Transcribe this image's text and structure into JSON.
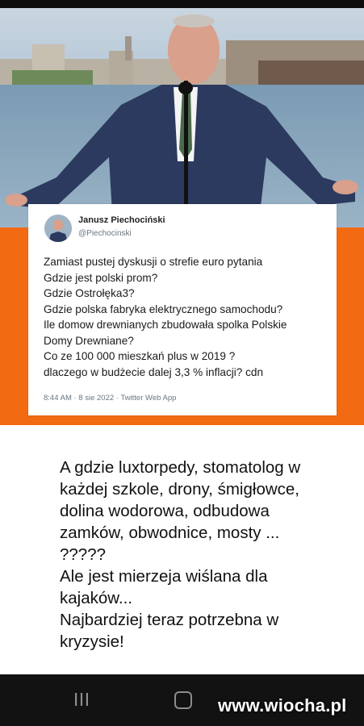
{
  "tweet": {
    "author_name": "Janusz Piechociński",
    "author_handle": "@Piechocinski",
    "lines": [
      "Zamiast pustej dyskusji o strefie euro pytania",
      "Gdzie jest polski prom?",
      "Gdzie Ostrołęka3?",
      "Gdzie polska fabryka elektrycznego samochodu?",
      "Ile domow drewnianych zbudowała spolka Polskie",
      "Domy Drewniane?",
      "Co ze 100 000 mieszkań plus w 2019 ?",
      "dlaczego w budżecie dalej 3,3 % inflacji? cdn"
    ],
    "meta": "8:44 AM · 8 sie 2022 · Twitter Web App"
  },
  "comment": {
    "lines": [
      "A gdzie luxtorpedy, stomatolog w",
      "każdej szkole, drony, śmigłowce,",
      "dolina wodorowa, odbudowa",
      "zamków, obwodnice, mosty ...",
      "?????",
      "Ale jest mierzeja wiślana dla",
      "kajaków...",
      "Najbardziej teraz potrzebna w",
      "kryzysie!"
    ]
  },
  "watermark": "www.wiocha.pl",
  "colors": {
    "orange": "#f26a12",
    "nav_bar": "#121212",
    "suit": "#2b3a5e"
  },
  "icons": {
    "nav_recents": "recents-icon",
    "nav_home": "home-icon"
  }
}
